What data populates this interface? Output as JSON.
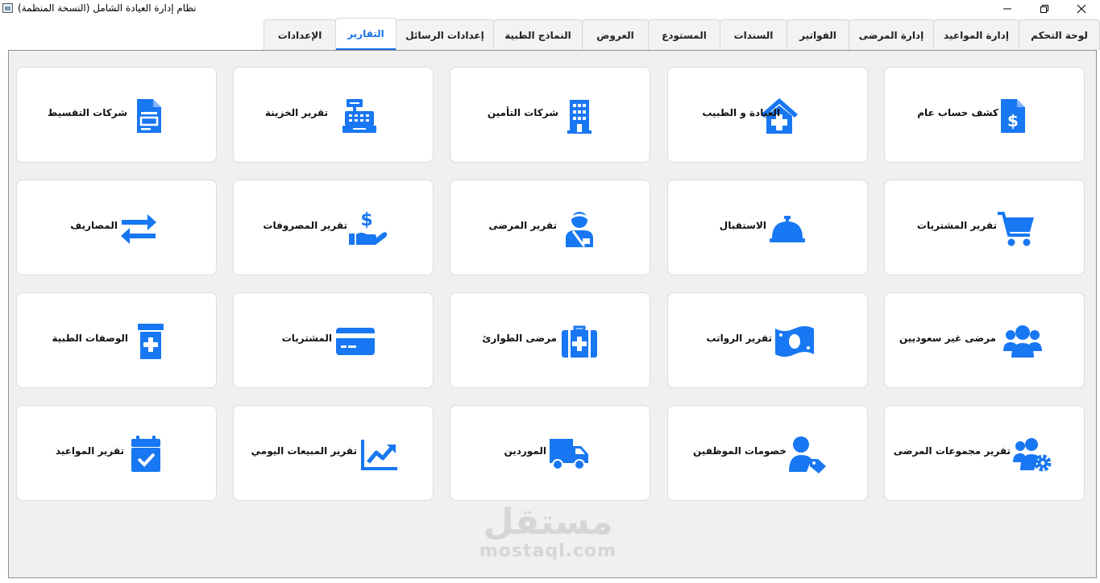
{
  "window": {
    "title": "نظام إدارة العيادة الشامل (النسخة المنظمة)"
  },
  "tabs": [
    {
      "id": "dashboard",
      "label": "لوحة التحكم"
    },
    {
      "id": "appointments",
      "label": "إدارة المواعيد"
    },
    {
      "id": "patients",
      "label": "إدارة المرضى"
    },
    {
      "id": "invoices",
      "label": "الفواتير"
    },
    {
      "id": "vouchers",
      "label": "السندات"
    },
    {
      "id": "warehouse",
      "label": "المستودع"
    },
    {
      "id": "offers",
      "label": "العروض"
    },
    {
      "id": "medical-forms",
      "label": "النماذج الطبية"
    },
    {
      "id": "message-settings",
      "label": "إعدادات الرسائل"
    },
    {
      "id": "reports",
      "label": "التقارير"
    },
    {
      "id": "settings",
      "label": "الإعدادات"
    }
  ],
  "active_tab": "التقارير",
  "accent_color": "#1a73e8",
  "icon_color": "#1877f2",
  "report_cards": [
    {
      "label": "كشف حساب عام",
      "icon": "invoice-dollar-icon"
    },
    {
      "label": "العيادة و الطبيب",
      "icon": "clinic-house-icon"
    },
    {
      "label": "شركات التأمين",
      "icon": "building-icon"
    },
    {
      "label": "تقرير الخزينة",
      "icon": "cash-register-icon"
    },
    {
      "label": "شركات التقسيط",
      "icon": "document-list-icon"
    },
    {
      "label": "تقرير المشتريات",
      "icon": "cart-icon"
    },
    {
      "label": "الاستقبال",
      "icon": "service-bell-icon"
    },
    {
      "label": "تقرير المرضى",
      "icon": "injured-patient-icon"
    },
    {
      "label": "تقرير المصروفات",
      "icon": "hand-dollar-icon"
    },
    {
      "label": "المصاريف",
      "icon": "exchange-arrows-icon"
    },
    {
      "label": "مرضى غير سعوديين",
      "icon": "users-icon"
    },
    {
      "label": "تقرير الرواتب",
      "icon": "money-bill-icon"
    },
    {
      "label": "مرضى الطوارئ",
      "icon": "medkit-icon"
    },
    {
      "label": "المشتريات",
      "icon": "credit-card-icon"
    },
    {
      "label": "الوصفات الطبية",
      "icon": "prescription-bottle-icon"
    },
    {
      "label": "تقرير مجموعات المرضى",
      "icon": "users-gear-icon"
    },
    {
      "label": "خصومات الموظفين",
      "icon": "user-tag-icon"
    },
    {
      "label": "الموردين",
      "icon": "truck-icon"
    },
    {
      "label": "تقرير المبيعات اليومي",
      "icon": "chart-line-icon"
    },
    {
      "label": "تقرير المواعيد",
      "icon": "calendar-check-icon"
    }
  ],
  "watermark": {
    "logo": "مستقل",
    "url": "mostaql.com"
  }
}
